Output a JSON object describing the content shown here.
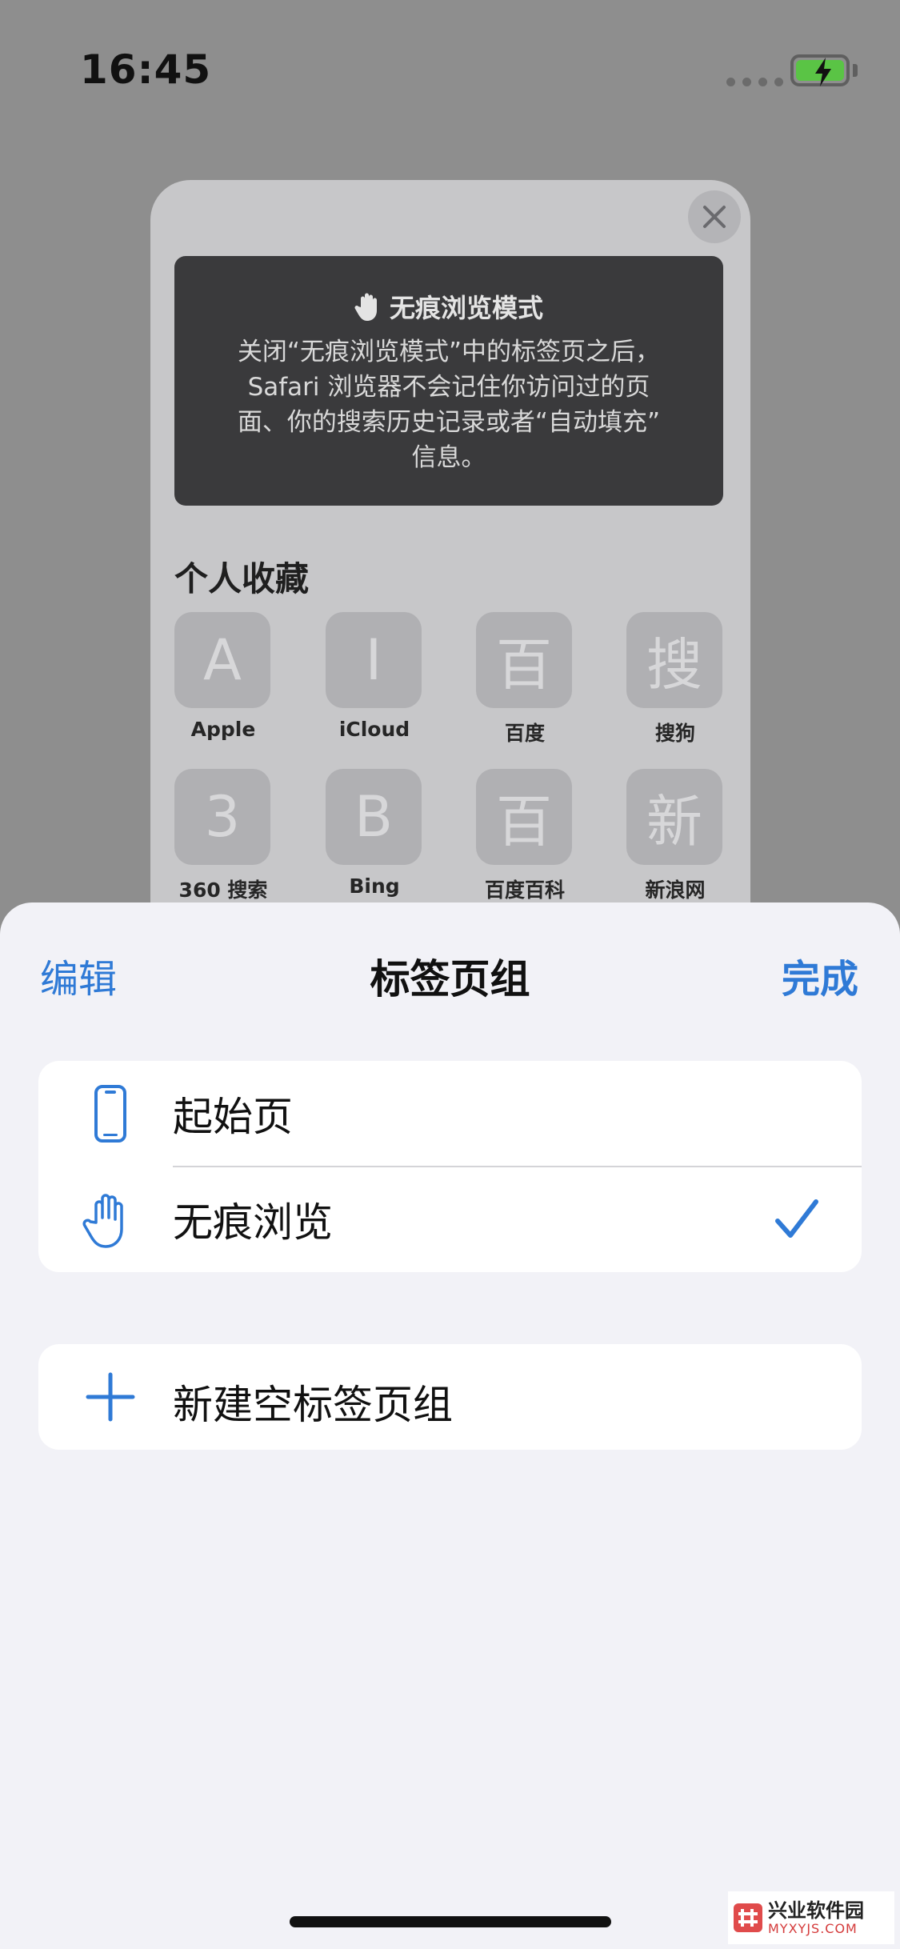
{
  "status_bar": {
    "time": "16:45",
    "battery_state": "charging",
    "battery_color": "#5ac445"
  },
  "preview": {
    "close_icon": "close-icon",
    "banner": {
      "icon": "hand-icon",
      "title": "无痕浏览模式",
      "lines": [
        "关闭“无痕浏览模式”中的标签页之后，",
        "Safari 浏览器不会记住你访问过的页",
        "面、你的搜索历史记录或者“自动填充”",
        "信息。"
      ]
    },
    "favorites": {
      "title": "个人收藏",
      "items": [
        {
          "glyph": "A",
          "label": "Apple"
        },
        {
          "glyph": "I",
          "label": "iCloud"
        },
        {
          "glyph": "百",
          "label": "百度"
        },
        {
          "glyph": "搜",
          "label": "搜狗"
        },
        {
          "glyph": "3",
          "label": "360 搜索"
        },
        {
          "glyph": "B",
          "label": "Bing"
        },
        {
          "glyph": "百",
          "label": "百度百科"
        },
        {
          "glyph": "新",
          "label": "新浪网"
        }
      ]
    }
  },
  "sheet": {
    "edit_label": "编辑",
    "title": "标签页组",
    "done_label": "完成",
    "accent_color": "#2f7ad6",
    "groups": [
      {
        "icon": "phone-icon",
        "label": "起始页",
        "selected": false
      },
      {
        "icon": "hand-icon",
        "label": "无痕浏览",
        "selected": true
      }
    ],
    "new_group": {
      "icon": "plus-icon",
      "label": "新建空标签页组"
    }
  },
  "watermark": {
    "main": "兴业软件园",
    "sub": "MYXYJS.COM"
  }
}
